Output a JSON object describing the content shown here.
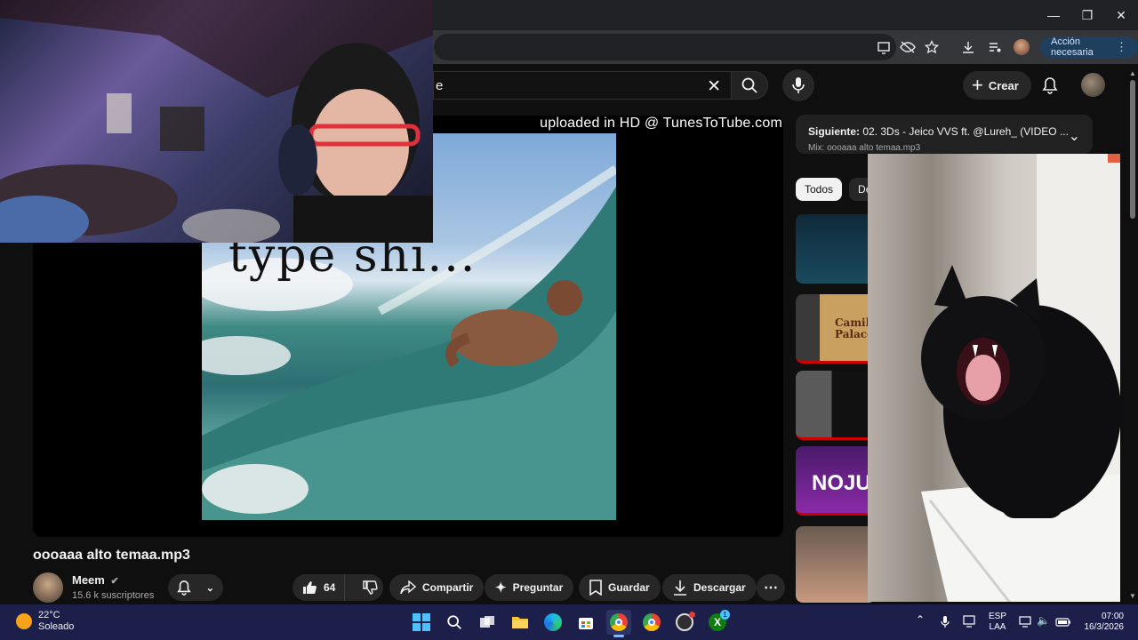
{
  "browser": {
    "action_button": "Acción necesaria"
  },
  "youtube": {
    "search_value": "e",
    "create_label": "Crear"
  },
  "player": {
    "watermark": "uploaded in HD @ TunesToTube.com",
    "meme_caption": "type shi..."
  },
  "video": {
    "title": "oooaaa alto temaa.mp3",
    "channel": "Meem",
    "subscribers": "15.6 k suscriptores",
    "like_count": "64",
    "share_label": "Compartir",
    "ask_label": "Preguntar",
    "save_label": "Guardar",
    "download_label": "Descargar"
  },
  "sidebar": {
    "queue_next_prefix": "Siguiente:",
    "queue_next_title": "02. 3Ds - Jeico VVS ft. @Lureh_ (VIDEO ...",
    "queue_mix": "Mix: oooaaa alto temaa.mp3",
    "chips": [
      "Todos",
      "De"
    ],
    "thumb_texts": [
      "Camila Palace",
      "NOJU"
    ]
  },
  "taskbar": {
    "weather_temp": "22°C",
    "weather_desc": "Soleado",
    "lang_1": "ESP",
    "lang_2": "LAA",
    "time": "07:00",
    "date": "16/3/2026",
    "xbox_badge": "1"
  },
  "colors": {
    "yt_bg": "#0f0f0f",
    "taskbar": "#1b1f4a",
    "accent_red": "#cc0000"
  }
}
